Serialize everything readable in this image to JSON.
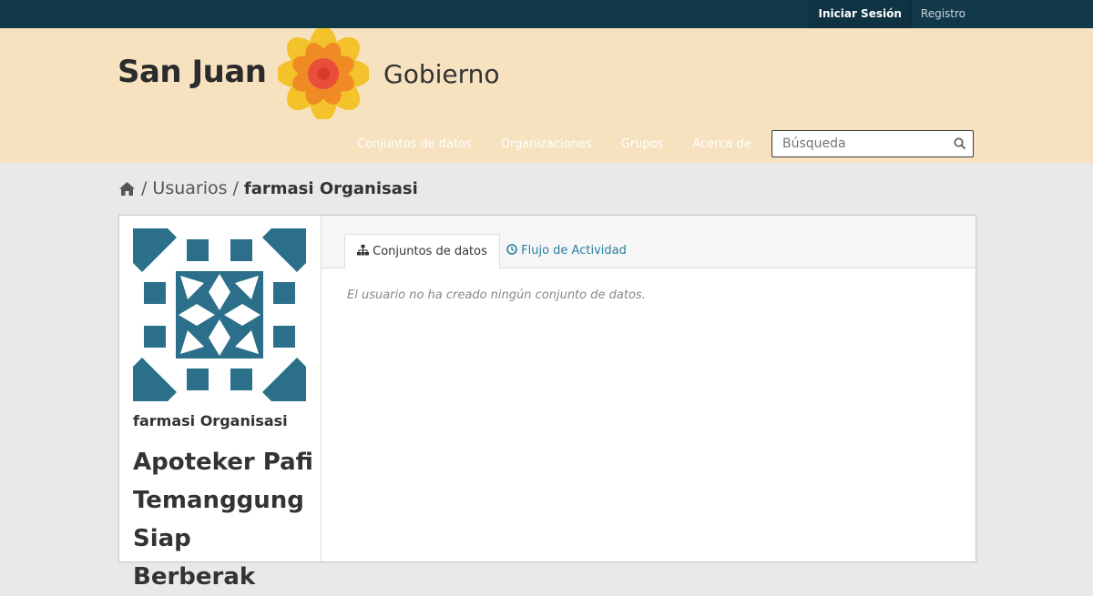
{
  "colors": {
    "topbar": "#12394a",
    "masthead": "#f7e2c0",
    "accent_link": "#2a7f9e",
    "avatar": "#2b6f8a"
  },
  "topbar": {
    "login_label": "Iniciar Sesión",
    "register_label": "Registro"
  },
  "brand": {
    "left_text": "San Juan",
    "right_text": "Gobierno"
  },
  "nav": {
    "items": [
      "Conjuntos de datos",
      "Organizaciones",
      "Grupos",
      "Acerca de"
    ]
  },
  "search": {
    "placeholder": "Búsqueda",
    "icon": "search-icon"
  },
  "breadcrumb": {
    "home_icon": "home-icon",
    "separator": "/",
    "users": "Usuarios",
    "current": "farmasi Organisasi"
  },
  "profile": {
    "username": "farmasi Organisasi",
    "fullname": "Apoteker Pafi Temanggung Siap Berberak"
  },
  "tabs": {
    "datasets": "Conjuntos de datos",
    "activity": "Flujo de Actividad"
  },
  "main": {
    "empty_message": "El usuario no ha creado ningún conjunto de datos."
  }
}
